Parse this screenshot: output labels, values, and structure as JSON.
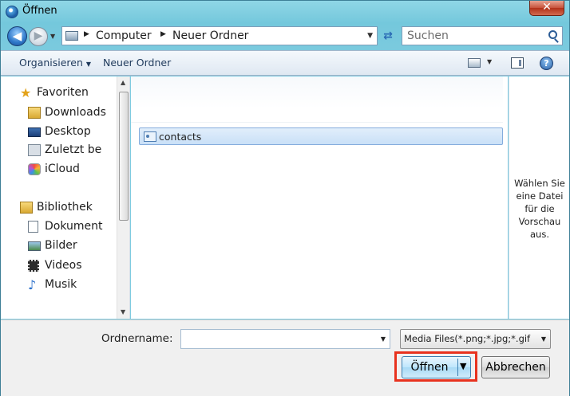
{
  "window": {
    "title": "Öffnen",
    "close_glyph": "✕"
  },
  "nav": {
    "back_glyph": "◀",
    "forward_glyph": "▶",
    "breadcrumb": [
      "Computer",
      "Neuer Ordner"
    ],
    "search_placeholder": "Suchen"
  },
  "toolbar": {
    "organize_label": "Organisieren",
    "new_folder_label": "Neuer Ordner",
    "help_glyph": "?"
  },
  "sidebar": {
    "favorites": {
      "label": "Favoriten",
      "items": [
        {
          "label": "Downloads",
          "icon": "downloads-folder-icon"
        },
        {
          "label": "Desktop",
          "icon": "desktop-icon"
        },
        {
          "label": "Zuletzt be",
          "icon": "recent-places-icon"
        },
        {
          "label": "iCloud",
          "icon": "icloud-icon"
        }
      ]
    },
    "libraries": {
      "label": "Bibliothek",
      "items": [
        {
          "label": "Dokument",
          "icon": "documents-icon"
        },
        {
          "label": "Bilder",
          "icon": "pictures-icon"
        },
        {
          "label": "Videos",
          "icon": "videos-icon"
        },
        {
          "label": "Musik",
          "icon": "music-icon"
        }
      ]
    }
  },
  "files": [
    {
      "name": "contacts",
      "selected": true
    }
  ],
  "preview": {
    "message": "Wählen Sie eine Datei für die Vorschau aus."
  },
  "footer": {
    "filename_label": "Ordnername:",
    "filename_value": "",
    "filter_value": "Media Files(*.png;*.jpg;*.gif",
    "open_label": "Öffnen",
    "cancel_label": "Abbrechen"
  },
  "colors": {
    "highlight": "#e8321e",
    "accent": "#3c7fb1"
  }
}
